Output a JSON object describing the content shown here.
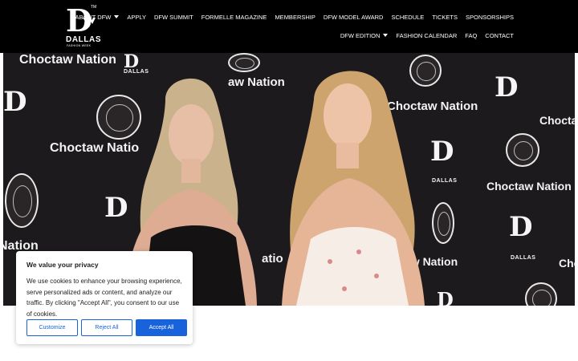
{
  "brand": {
    "logo_letter": "D",
    "trademark": "TM",
    "name": "DALLAS",
    "tagline": "FASHION WEEK"
  },
  "nav": {
    "row1": [
      {
        "label": "ABOUT DFW",
        "dropdown": true
      },
      {
        "label": "APPLY",
        "dropdown": false
      },
      {
        "label": "DFW SUMMIT",
        "dropdown": false
      },
      {
        "label": "FORMELLE MAGAZINE",
        "dropdown": false
      },
      {
        "label": "MEMBERSHIP",
        "dropdown": false
      },
      {
        "label": "DFW MODEL AWARD",
        "dropdown": false
      },
      {
        "label": "SCHEDULE",
        "dropdown": false
      },
      {
        "label": "TICKETS",
        "dropdown": false
      },
      {
        "label": "SPONSORSHIPS",
        "dropdown": false
      }
    ],
    "row2": [
      {
        "label": "DFW EDITION",
        "dropdown": true
      },
      {
        "label": "FASHION CALENDAR",
        "dropdown": false
      },
      {
        "label": "FAQ",
        "dropdown": false
      },
      {
        "label": "CONTACT",
        "dropdown": false
      }
    ]
  },
  "hero": {
    "sponsor_text": "Choctaw Nation",
    "sponsor_fragment_1": "Choctaw Natio",
    "sponsor_fragment_2": "aw Nation",
    "sponsor_fragment_3": "Nation",
    "sponsor_fragment_4": "Choctaw",
    "sponsor_fragment_5": "Chocta",
    "sponsor_fragment_6": "atio",
    "logo_letter": "D",
    "logo_name": "DALLAS",
    "logo_sub": "FASHION WEEK"
  },
  "cookie_banner": {
    "title": "We value your privacy",
    "text": "We use cookies to enhance your browsing experience, serve personalized ads or content, and analyze our traffic. By clicking \"Accept All\", you consent to our use of cookies.",
    "customize_label": "Customize",
    "reject_label": "Reject All",
    "accept_label": "Accept All"
  },
  "colors": {
    "header_bg": "#000000",
    "accent_blue": "#1863dc",
    "backdrop": "#1c1a1c"
  }
}
